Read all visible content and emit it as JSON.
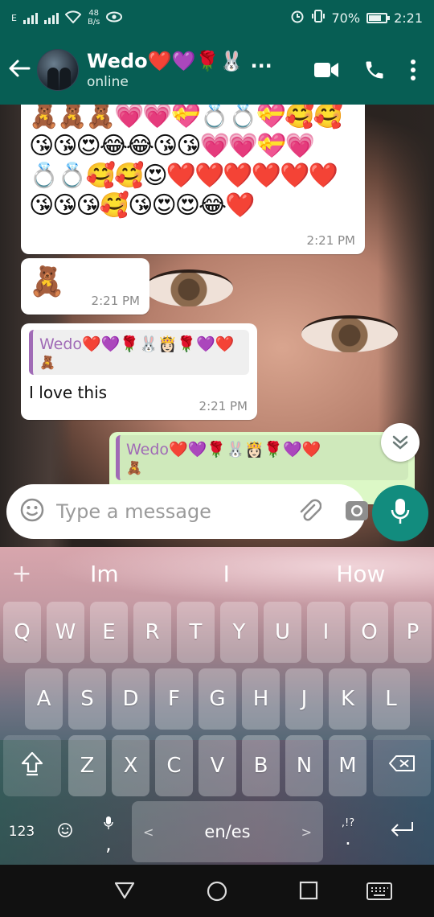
{
  "status_bar": {
    "carrier_indicator": "E",
    "network_speed_value": "48",
    "network_speed_unit": "B/s",
    "battery": "70%",
    "time": "2:21"
  },
  "header": {
    "contact_name": "Wedo❤️💜🌹🐰 ...",
    "status": "online"
  },
  "messages": [
    {
      "emoji_lines": [
        "🧸🧸🧸💗💗💝💍💍💝🥰🥰",
        "😘😘😍😂😂😘😘💗💗💝💗",
        "💍💍🥰🥰😍❤️❤️❤️❤️❤️❤️",
        "😘😘😘🥰😘😍😍😂❤️"
      ],
      "time": "2:21 PM"
    },
    {
      "emoji": "🧸",
      "time": "2:21 PM"
    },
    {
      "quote_name": "Wedo❤️💜🌹🐰👸🏻🌹💜❤️",
      "quote_text": "🧸",
      "text": "I love this",
      "time": "2:21 PM"
    },
    {
      "quote_name": "Wedo❤️💜🌹🐰👸🏻🌹💜❤️",
      "quote_text": "🧸"
    }
  ],
  "composer": {
    "placeholder": "Type a message"
  },
  "keyboard": {
    "suggestions": [
      "Im",
      "I",
      "How"
    ],
    "row1": [
      "Q",
      "W",
      "E",
      "R",
      "T",
      "Y",
      "U",
      "I",
      "O",
      "P"
    ],
    "row2": [
      "A",
      "S",
      "D",
      "F",
      "G",
      "H",
      "J",
      "K",
      "L"
    ],
    "row3": [
      "Z",
      "X",
      "C",
      "V",
      "B",
      "N",
      "M"
    ],
    "symbols_key": "123",
    "comma_key": ",",
    "space_label": "en/es",
    "period_key": ".",
    "punct_hint": ",!?"
  },
  "icons": {
    "back": "back-arrow-icon",
    "video": "video-call-icon",
    "call": "phone-icon",
    "menu": "more-vert-icon",
    "emoji": "emoji-icon",
    "attach": "paperclip-icon",
    "camera": "camera-icon",
    "mic": "mic-icon",
    "scroll": "chevron-double-down-icon"
  },
  "colors": {
    "header": "#075e54",
    "accent": "#128c7e",
    "outgoing_bubble": "#dcf8c6",
    "quote_name": "#a06bb6"
  }
}
